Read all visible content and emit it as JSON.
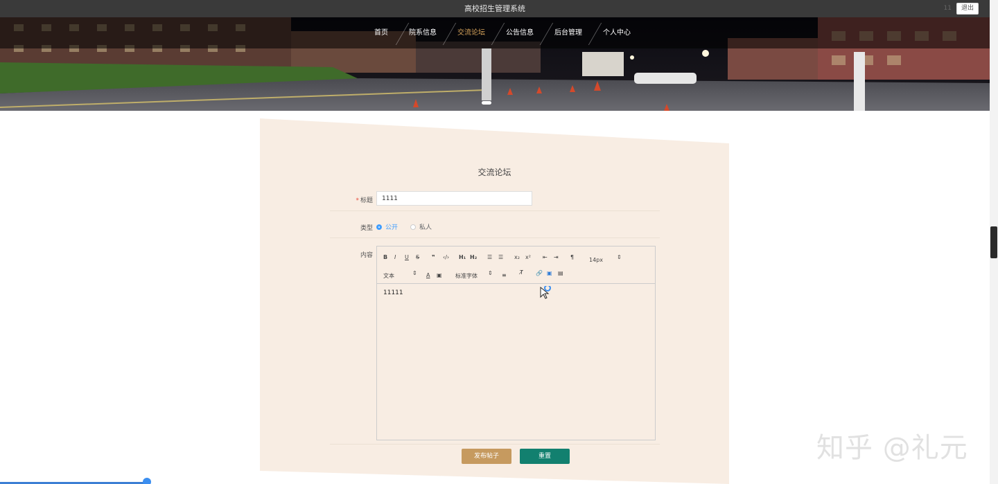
{
  "header": {
    "site_title": "高校招生管理系统",
    "user_name": "11",
    "logout_label": "退出"
  },
  "nav": {
    "items": [
      {
        "label": "首页",
        "active": false
      },
      {
        "label": "院系信息",
        "active": false
      },
      {
        "label": "交流论坛",
        "active": true
      },
      {
        "label": "公告信息",
        "active": false
      },
      {
        "label": "后台管理",
        "active": false
      },
      {
        "label": "个人中心",
        "active": false
      }
    ]
  },
  "form": {
    "title": "交流论坛",
    "title_label": "标题",
    "required_mark": "*",
    "title_value": "1111",
    "type_label": "类型",
    "type_options": [
      {
        "label": "公开",
        "checked": true
      },
      {
        "label": "私人",
        "checked": false
      }
    ],
    "content_label": "内容",
    "editor": {
      "font_size": "14px",
      "header_select": "文本",
      "font_select": "标准字体",
      "content": "11111"
    },
    "publish_label": "发布帖子",
    "reset_label": "重置"
  },
  "watermark": "知乎 @礼元",
  "colors": {
    "accent": "#c69a5f",
    "reset": "#12806f",
    "active_nav": "#d8a55c",
    "radio": "#409eff",
    "panel": "#f8ede3"
  }
}
